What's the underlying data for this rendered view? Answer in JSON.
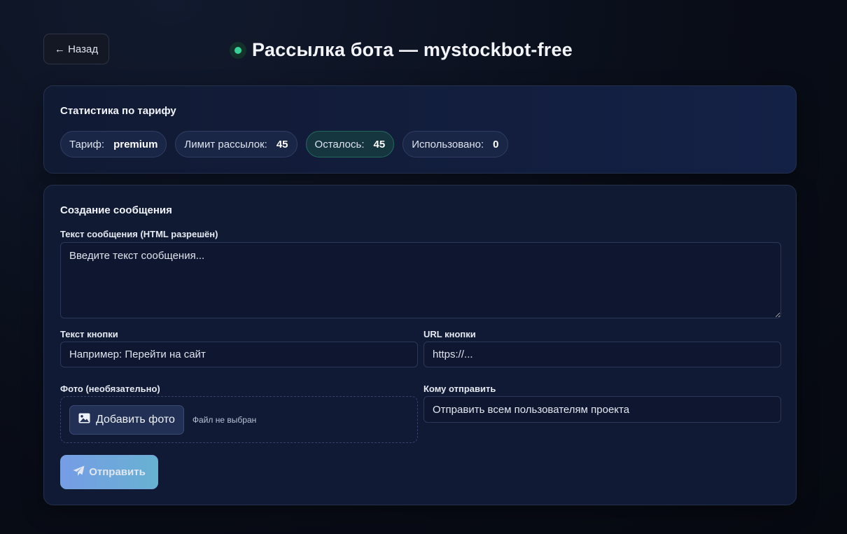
{
  "header": {
    "back_label": "← Назад",
    "title": "Рассылка бота — mystockbot-free"
  },
  "stats": {
    "title": "Статистика по тарифу",
    "chips": [
      {
        "label": "Тариф:",
        "value": "premium"
      },
      {
        "label": "Лимит рассылок:",
        "value": "45"
      },
      {
        "label": "Осталось:",
        "value": "45"
      },
      {
        "label": "Использовано:",
        "value": "0"
      }
    ]
  },
  "compose": {
    "title": "Создание сообщения",
    "message_label": "Текст сообщения (HTML разрешён)",
    "message_placeholder": "Введите текст сообщения...",
    "button_text_label": "Текст кнопки",
    "button_text_placeholder": "Например: Перейти на сайт",
    "button_url_label": "URL кнопки",
    "button_url_placeholder": "https://...",
    "photo_label": "Фото (необязательно)",
    "add_photo_label": "Добавить фото",
    "file_status": "Файл не выбран",
    "recipients_label": "Кому отправить",
    "recipients_value": "Отправить всем пользователям проекта",
    "send_label": "Отправить"
  },
  "colors": {
    "accent_green": "#34d399",
    "send_gradient_start": "#7fa8f5",
    "send_gradient_end": "#6fbfe0"
  },
  "icons": {
    "status": "status-dot-icon",
    "photo": "image-icon",
    "send": "paper-plane-icon"
  }
}
